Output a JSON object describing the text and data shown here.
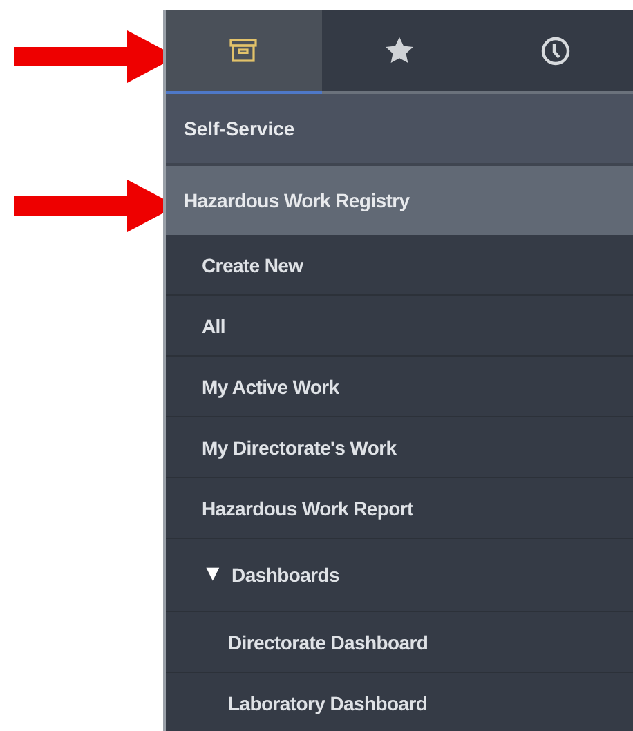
{
  "tabs": [
    {
      "kind": "box",
      "selected": true
    },
    {
      "kind": "star",
      "selected": false
    },
    {
      "kind": "clock",
      "selected": false
    }
  ],
  "menu": {
    "section": "Self-Service",
    "module": {
      "label": "Hazardous Work Registry",
      "selected": true
    },
    "items": [
      {
        "label": "Create New"
      },
      {
        "label": "All"
      },
      {
        "label": "My Active Work"
      },
      {
        "label": "My Directorate's Work"
      },
      {
        "label": "Hazardous Work Report"
      },
      {
        "label": "Dashboards",
        "toggle": "▼",
        "expanded": true,
        "children": [
          {
            "label": "Directorate Dashboard"
          },
          {
            "label": "Laboratory Dashboard"
          }
        ]
      }
    ]
  }
}
